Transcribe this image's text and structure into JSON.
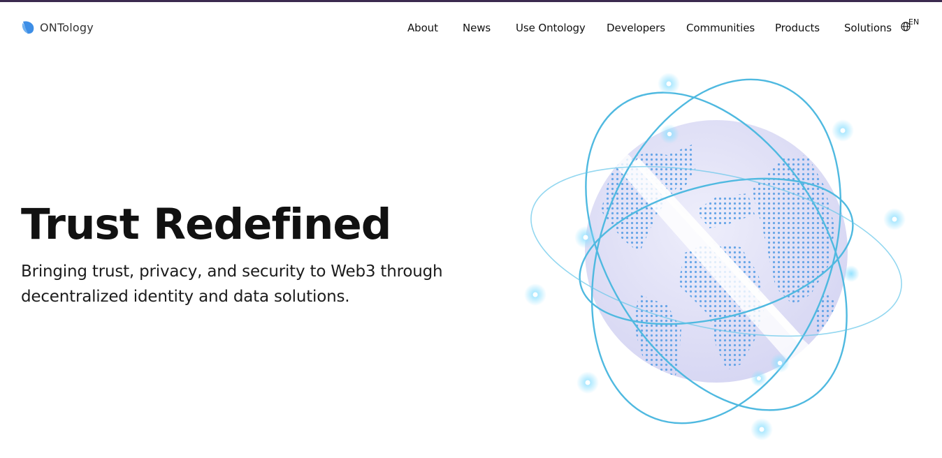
{
  "brand": {
    "name_main": "ONT",
    "name_rest": "ology",
    "logo_icon": "ontology-logo-icon",
    "color": "#3d8ee6"
  },
  "nav": {
    "items": [
      {
        "label": "About"
      },
      {
        "label": "News"
      },
      {
        "label": "Use Ontology"
      },
      {
        "label": "Developers"
      },
      {
        "label": "Communities"
      },
      {
        "label": "Products"
      },
      {
        "label": "Solutions"
      }
    ],
    "language": {
      "icon": "globe-icon",
      "label": "EN"
    }
  },
  "hero": {
    "title": "Trust Redefined",
    "subtitle": "Bringing trust, privacy, and security to Web3 through decentralized identity and data solutions.",
    "illustration": "globe-with-orbits-illustration"
  },
  "colors": {
    "topbar": "#3b2a4f",
    "orbit": "#4fb9e0",
    "globe": "#e3e3f7",
    "dots": "#5a9fe6",
    "text": "#111111"
  }
}
